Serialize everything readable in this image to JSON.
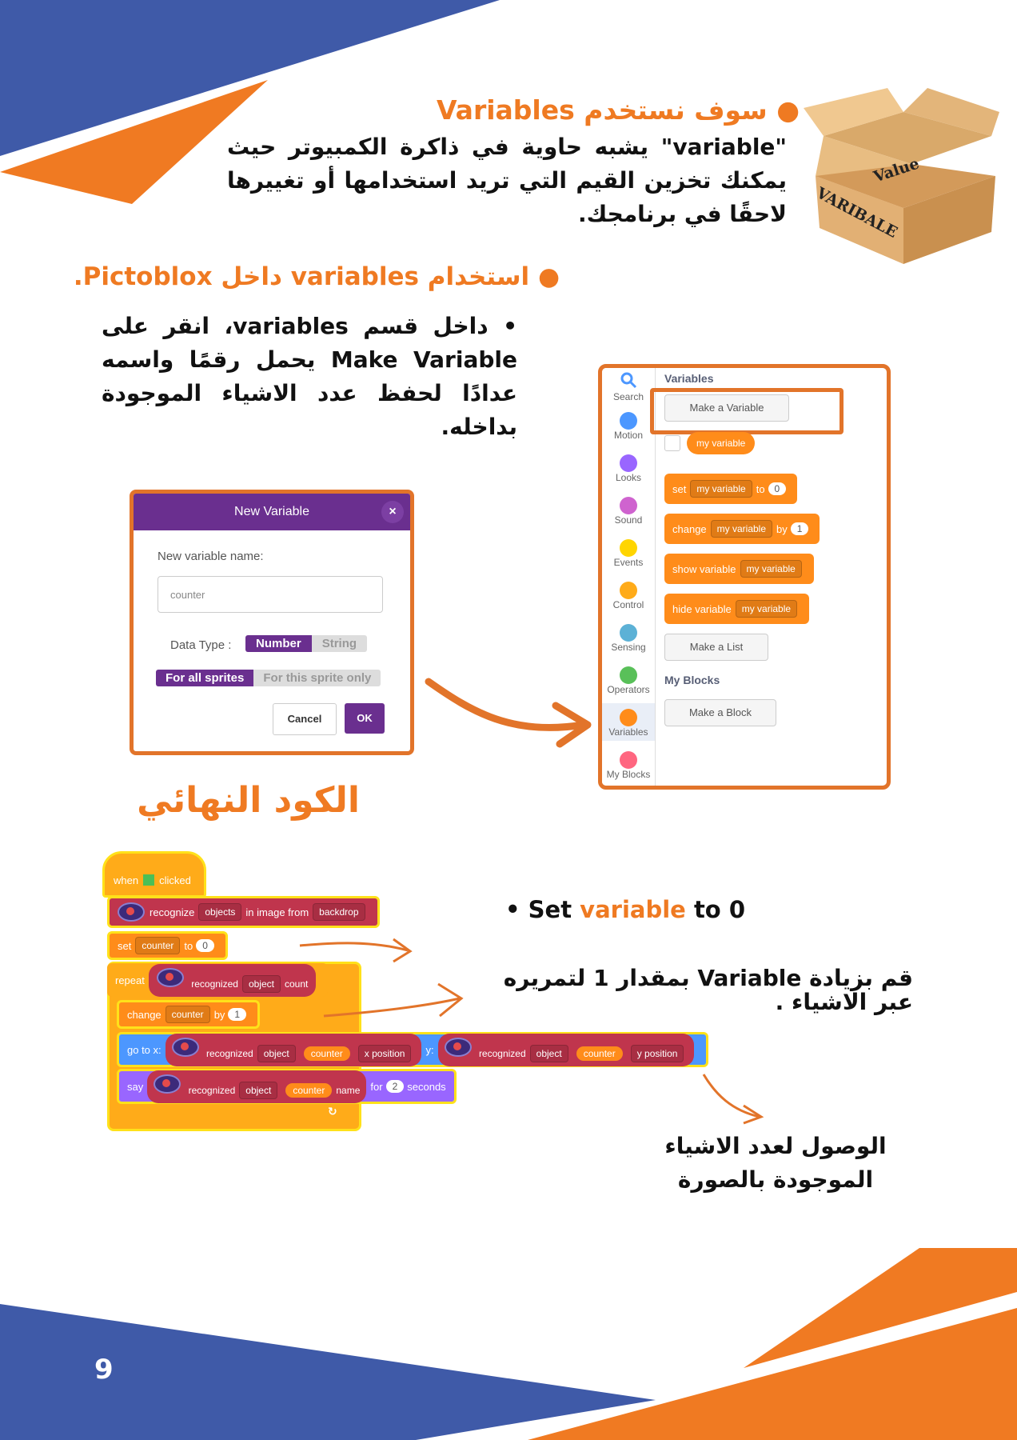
{
  "section1": {
    "heading_ar": "سوف نستخدم",
    "heading_en": "Variables",
    "body": "\"variable\" يشبه حاوية في ذاكرة الكمبيوتر حيث يمكنك تخزين القيم التي تريد استخدامها أو تغييرها لاحقًا في برنامجك."
  },
  "box_image": {
    "value_label": "Value",
    "name_label": "VARIBALE"
  },
  "section2": {
    "heading_ar1": "استخدام",
    "heading_en1": "variables",
    "heading_ar2": "داخل",
    "heading_en2": "Pictoblox.",
    "body": "داخل قسم variables، انقر على Make Variable يحمل رقمًا واسمه عدادًا لحفظ عدد الاشياء الموجودة بداخله."
  },
  "dialog": {
    "title": "New Variable",
    "close": "×",
    "label": "New variable name:",
    "value": "counter",
    "data_type_label": "Data Type :",
    "type_options": [
      "Number",
      "String"
    ],
    "scope_options": [
      "For all sprites",
      "For this sprite only"
    ],
    "cancel": "Cancel",
    "ok": "OK"
  },
  "palette": {
    "categories": [
      {
        "label": "Search",
        "color": "#4c97ff",
        "icon": "search-icon"
      },
      {
        "label": "Motion",
        "color": "#4c97ff"
      },
      {
        "label": "Looks",
        "color": "#9966ff"
      },
      {
        "label": "Sound",
        "color": "#cf63cf"
      },
      {
        "label": "Events",
        "color": "#ffd500"
      },
      {
        "label": "Control",
        "color": "#ffab19"
      },
      {
        "label": "Sensing",
        "color": "#5cb1d6"
      },
      {
        "label": "Operators",
        "color": "#59c059"
      },
      {
        "label": "Variables",
        "color": "#ff8c1a"
      },
      {
        "label": "My Blocks",
        "color": "#ff6680"
      }
    ],
    "section_title": "Variables",
    "make_variable": "Make a Variable",
    "my_variable": "my variable",
    "set_block": {
      "op": "set",
      "var": "my variable",
      "to": "to",
      "value": "0"
    },
    "change_block": {
      "op": "change",
      "var": "my variable",
      "by": "by",
      "value": "1"
    },
    "show_block": {
      "op": "show variable",
      "var": "my variable"
    },
    "hide_block": {
      "op": "hide variable",
      "var": "my variable"
    },
    "make_list": "Make a List",
    "my_blocks_title": "My Blocks",
    "make_block": "Make a Block"
  },
  "final_code_title": "الكود النهائي",
  "code": {
    "when": "when",
    "clicked": "clicked",
    "recognize": "recognize",
    "objects": "objects",
    "in_image_from": "in image from",
    "backdrop": "backdrop",
    "set": "set",
    "counter": "counter",
    "to": "to",
    "zero": "0",
    "repeat": "repeat",
    "recognized": "recognized",
    "object": "object",
    "count": "count",
    "change": "change",
    "by": "by",
    "one": "1",
    "go_to_x": "go to x:",
    "x_position": "x position",
    "y": "y:",
    "y_position": "y position",
    "say": "say",
    "name": "name",
    "for": "for",
    "two": "2",
    "seconds": "seconds",
    "loop_arrow": "↻"
  },
  "notes": {
    "set_note_a": "Set",
    "set_note_b": "variable",
    "set_note_c": "to 0",
    "increase_note": "قم بزيادة Variable بمقدار 1 لتمريره عبر الاشياء .",
    "access_note": "الوصول لعدد الاشياء الموجودة بالصورة"
  },
  "page_number": "9",
  "colors": {
    "blue": "#3d5aa6",
    "orange": "#f07a22",
    "purple": "#6c2f91"
  }
}
